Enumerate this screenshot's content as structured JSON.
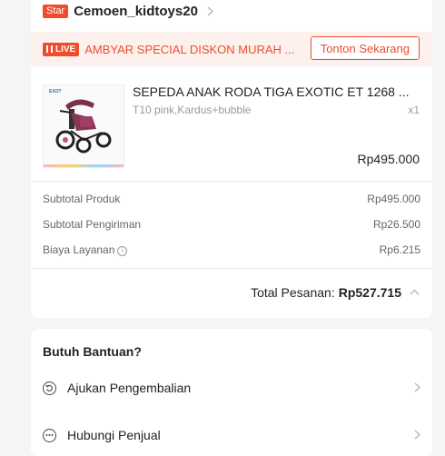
{
  "shop": {
    "badge": "Star",
    "name": "Cemoen_kidtoys20",
    "chevron": "chevron-right-icon"
  },
  "live": {
    "badge": "LIVE",
    "text": "AMBYAR SPECIAL DISKON MURAH ...",
    "button": "Tonton Sekarang"
  },
  "product": {
    "title": "SEPEDA ANAK RODA TIGA EXOTIC ET 1268 ...",
    "variant": "T10 pink,Kardus+bubble",
    "qty": "x1",
    "price": "Rp495.000",
    "thumb_logo": "EXOT"
  },
  "summary": {
    "rows": [
      {
        "label": "Subtotal Produk",
        "value": "Rp495.000"
      },
      {
        "label": "Subtotal Pengiriman",
        "value": "Rp26.500"
      },
      {
        "label": "Biaya Layanan",
        "value": "Rp6.215"
      }
    ],
    "total_label": "Total Pesanan:",
    "total_value": "Rp527.715"
  },
  "help": {
    "title": "Butuh Bantuan?",
    "items": [
      {
        "label": "Ajukan Pengembalian",
        "icon": "return-icon"
      },
      {
        "label": "Hubungi Penjual",
        "icon": "chat-icon"
      }
    ]
  },
  "colors": {
    "accent": "#ee4d2d",
    "background": "#f5f5f5",
    "muted_text": "#999999"
  }
}
